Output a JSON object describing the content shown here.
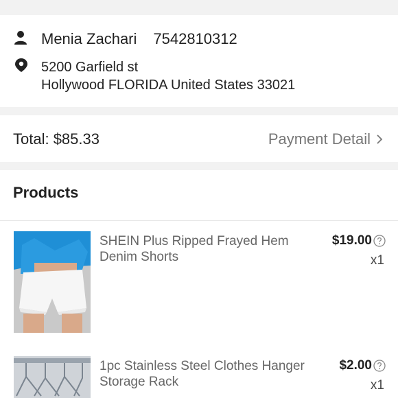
{
  "address": {
    "name": "Menia Zachari",
    "phone": "7542810312",
    "street": "5200 Garfield st",
    "city_line": "Hollywood FLORIDA United States 33021"
  },
  "summary": {
    "total": "Total: $85.33",
    "payment_detail": "Payment Detail"
  },
  "products": {
    "title": "Products",
    "items": [
      {
        "name": "SHEIN Plus Ripped Frayed Hem Denim Shorts",
        "price": "$19.00",
        "qty": "x1",
        "icon": "help-circle-icon"
      },
      {
        "name": "1pc Stainless Steel Clothes Hanger Storage Rack",
        "price": "$2.00",
        "qty": "x1",
        "icon": "help-circle-icon"
      }
    ]
  },
  "colors": {
    "background_gap": "#f2f2f2",
    "text_primary": "#222222",
    "text_secondary": "#777777"
  }
}
